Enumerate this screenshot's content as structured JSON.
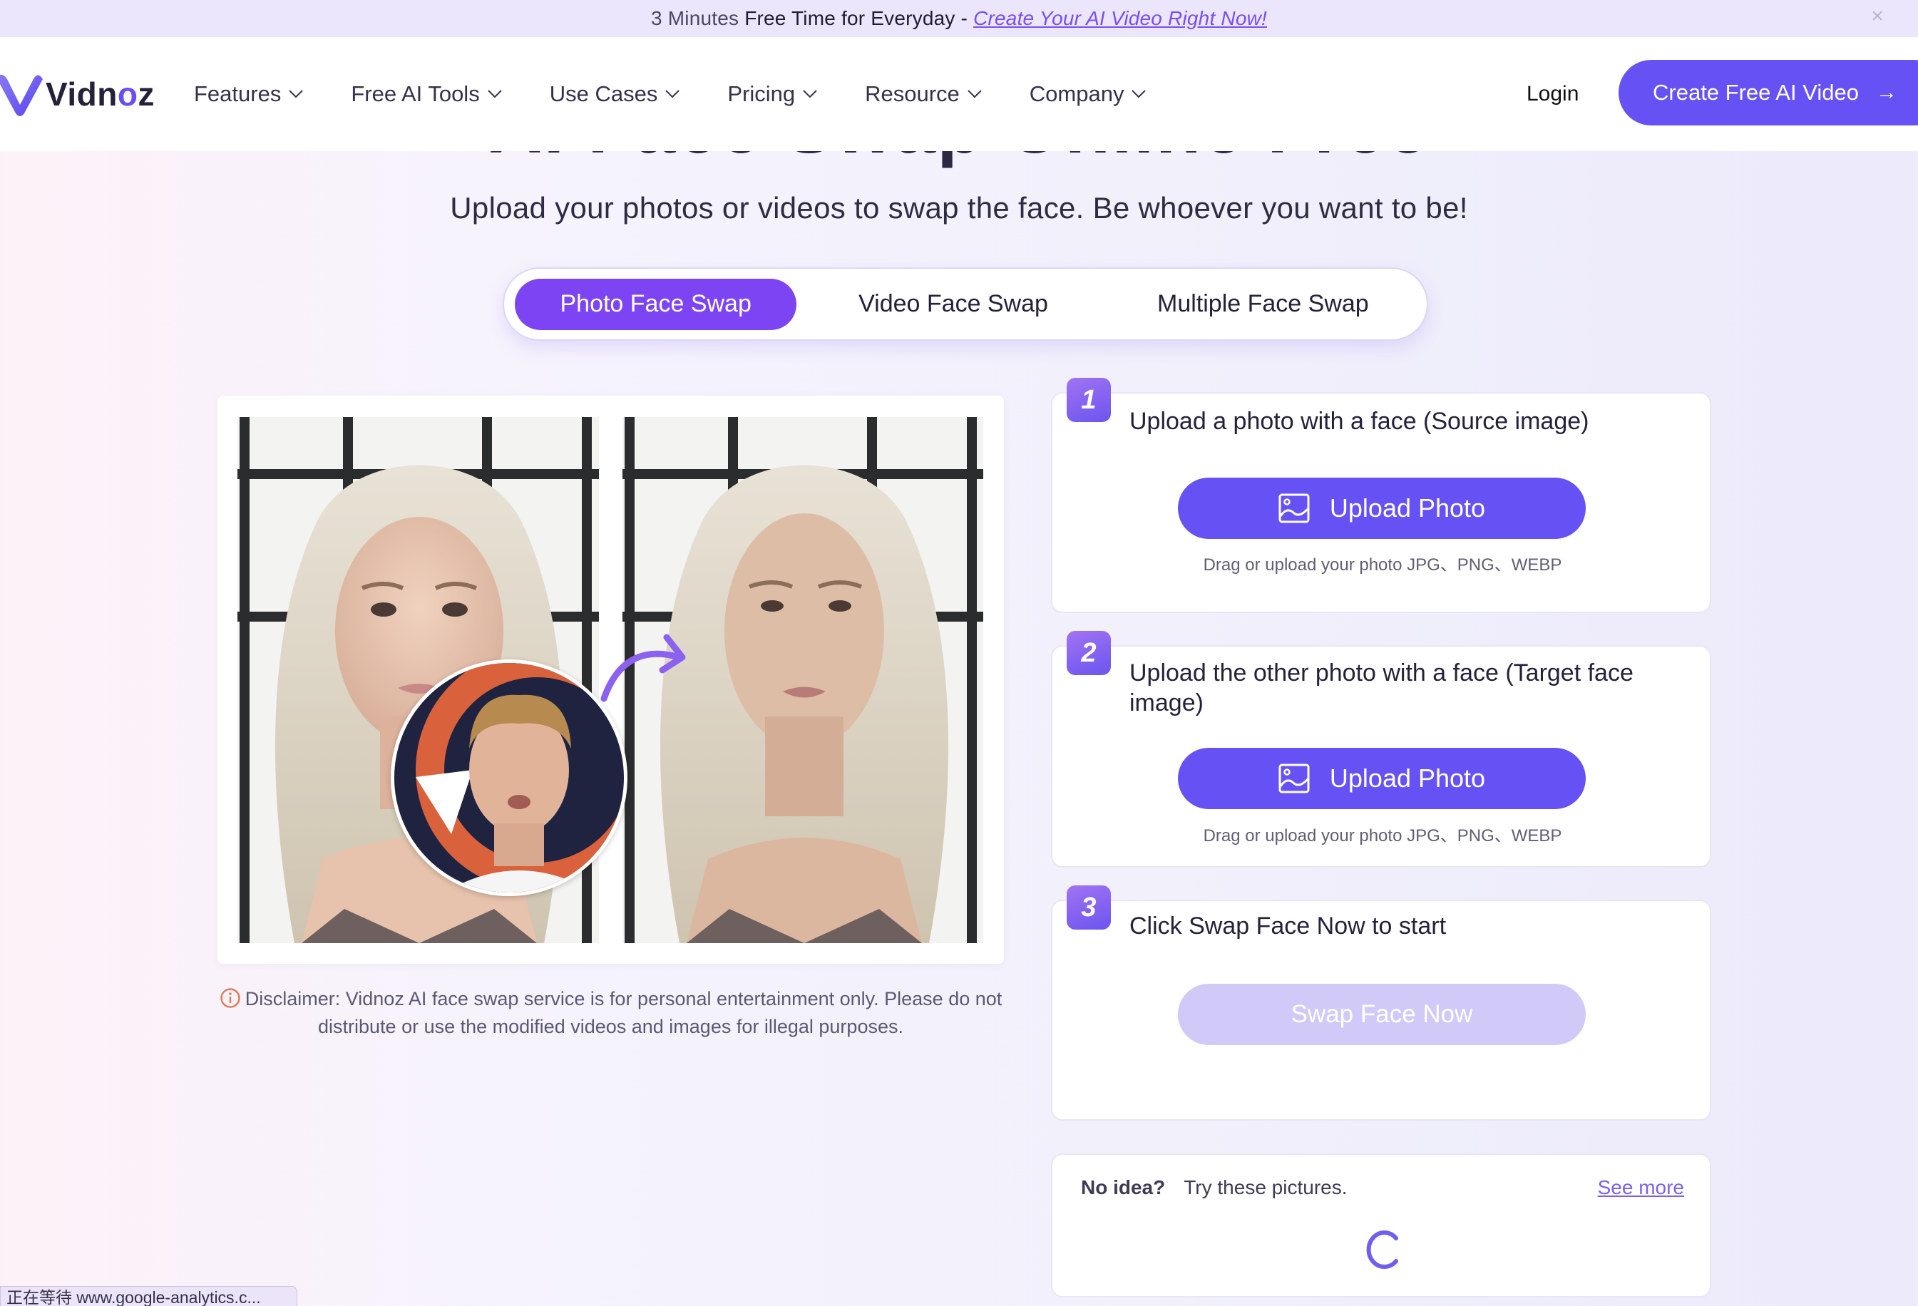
{
  "banner": {
    "lead": "3 Minutes",
    "text": "Free Time for Everyday - ",
    "link": "Create Your AI Video Right Now!",
    "close_icon": "close-icon"
  },
  "header": {
    "logo_text_pre": "Vidn",
    "logo_text_o": "o",
    "logo_text_post": "z",
    "nav": [
      {
        "label": "Features"
      },
      {
        "label": "Free AI Tools"
      },
      {
        "label": "Use Cases"
      },
      {
        "label": "Pricing"
      },
      {
        "label": "Resource"
      },
      {
        "label": "Company"
      }
    ],
    "login": "Login",
    "cta": "Create Free AI Video",
    "cta_arrow": "→"
  },
  "hero": {
    "title": "AI Face Swap Online Free",
    "subtitle": "Upload your photos or videos to swap the face. Be whoever you want to be!"
  },
  "tabs": [
    {
      "label": "Photo Face Swap",
      "active": true
    },
    {
      "label": "Video Face Swap",
      "active": false
    },
    {
      "label": "Multiple Face Swap",
      "active": false
    }
  ],
  "disclaimer": "Disclaimer: Vidnoz AI face swap service is for personal entertainment only. Please do not distribute or use the modified videos and images for illegal purposes.",
  "steps": [
    {
      "number": "1",
      "title": "Upload a photo with a face (Source image)",
      "button": "Upload Photo",
      "hint": "Drag or upload your photo JPG、PNG、WEBP"
    },
    {
      "number": "2",
      "title": "Upload the other photo with a face (Target face image)",
      "button": "Upload Photo",
      "hint": "Drag or upload your photo JPG、PNG、WEBP"
    },
    {
      "number": "3",
      "title": "Click Swap Face Now to start",
      "button": "Swap Face Now"
    }
  ],
  "ideas": {
    "bold": "No idea?",
    "text": "Try these pictures.",
    "see_more": "See more"
  },
  "status_bar": "正在等待 www.google-analytics.c...",
  "colors": {
    "accent": "#6652f4",
    "tab_active": "#7c44f2",
    "disabled_button": "#d1caf9",
    "banner_bg": "#ebe6fc",
    "link": "#7a4df0"
  }
}
